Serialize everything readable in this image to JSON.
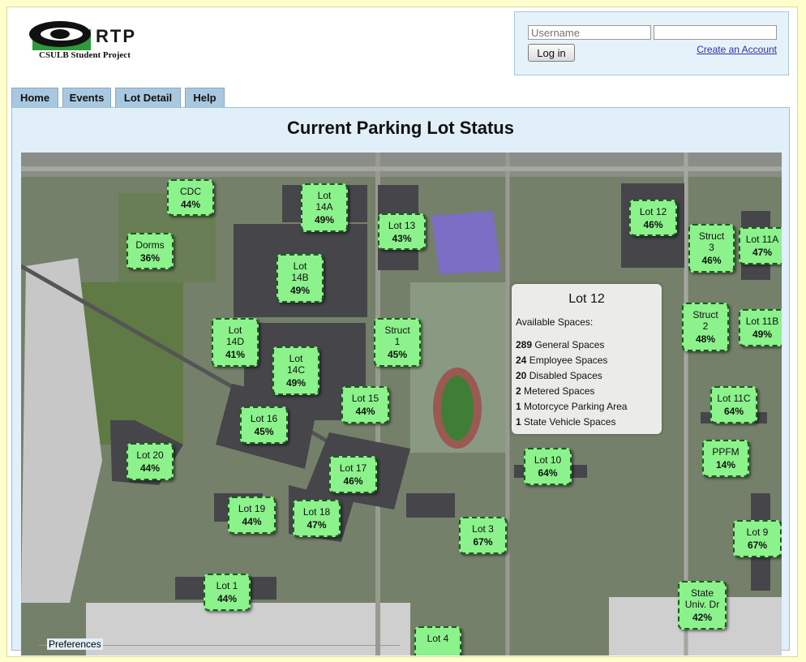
{
  "brand": {
    "name": "RTP",
    "subtitle": "CSULB Student Project"
  },
  "login": {
    "username_placeholder": "Username",
    "password_placeholder": "",
    "button": "Log in",
    "create_link": "Create an Account"
  },
  "tabs": [
    {
      "label": "Home"
    },
    {
      "label": "Events"
    },
    {
      "label": "Lot Detail"
    },
    {
      "label": "Help"
    }
  ],
  "page_title": "Current Parking Lot Status",
  "lots": [
    {
      "label": "CDC",
      "pct": "44%"
    },
    {
      "label": "Lot 14A",
      "pct": "49%"
    },
    {
      "label": "Lot 13",
      "pct": "43%"
    },
    {
      "label": "Lot 12",
      "pct": "46%"
    },
    {
      "label": "Struct 3",
      "pct": "46%"
    },
    {
      "label": "Lot 11A",
      "pct": "47%"
    },
    {
      "label": "Dorms",
      "pct": "36%"
    },
    {
      "label": "Lot 14B",
      "pct": "49%"
    },
    {
      "label": "Struct 2",
      "pct": "48%"
    },
    {
      "label": "Lot 11B",
      "pct": "49%"
    },
    {
      "label": "Lot 14D",
      "pct": "41%"
    },
    {
      "label": "Lot 14C",
      "pct": "49%"
    },
    {
      "label": "Struct 1",
      "pct": "45%"
    },
    {
      "label": "Lot 15",
      "pct": "44%"
    },
    {
      "label": "Lot 11C",
      "pct": "64%"
    },
    {
      "label": "Lot 16",
      "pct": "45%"
    },
    {
      "label": "Lot 20",
      "pct": "44%"
    },
    {
      "label": "PPFM",
      "pct": "14%"
    },
    {
      "label": "Lot 17",
      "pct": "46%"
    },
    {
      "label": "Lot 10",
      "pct": "64%"
    },
    {
      "label": "Lot 19",
      "pct": "44%"
    },
    {
      "label": "Lot 18",
      "pct": "47%"
    },
    {
      "label": "Lot 3",
      "pct": "67%"
    },
    {
      "label": "Lot 9",
      "pct": "67%"
    },
    {
      "label": "Lot 1",
      "pct": "44%"
    },
    {
      "label": "State Univ. Dr",
      "pct": "42%"
    },
    {
      "label": "Lot 4",
      "pct": ""
    }
  ],
  "popup": {
    "title": "Lot 12",
    "subtitle": "Available Spaces:",
    "rows": [
      {
        "count": "289",
        "label": "General Spaces"
      },
      {
        "count": "24",
        "label": "Employee Spaces"
      },
      {
        "count": "20",
        "label": "Disabled Spaces"
      },
      {
        "count": "2",
        "label": "Metered Spaces"
      },
      {
        "count": "1",
        "label": "Motorcyce Parking Area"
      },
      {
        "count": "1",
        "label": "State Vehicle Spaces"
      }
    ]
  },
  "preferences_label": "Preferences"
}
